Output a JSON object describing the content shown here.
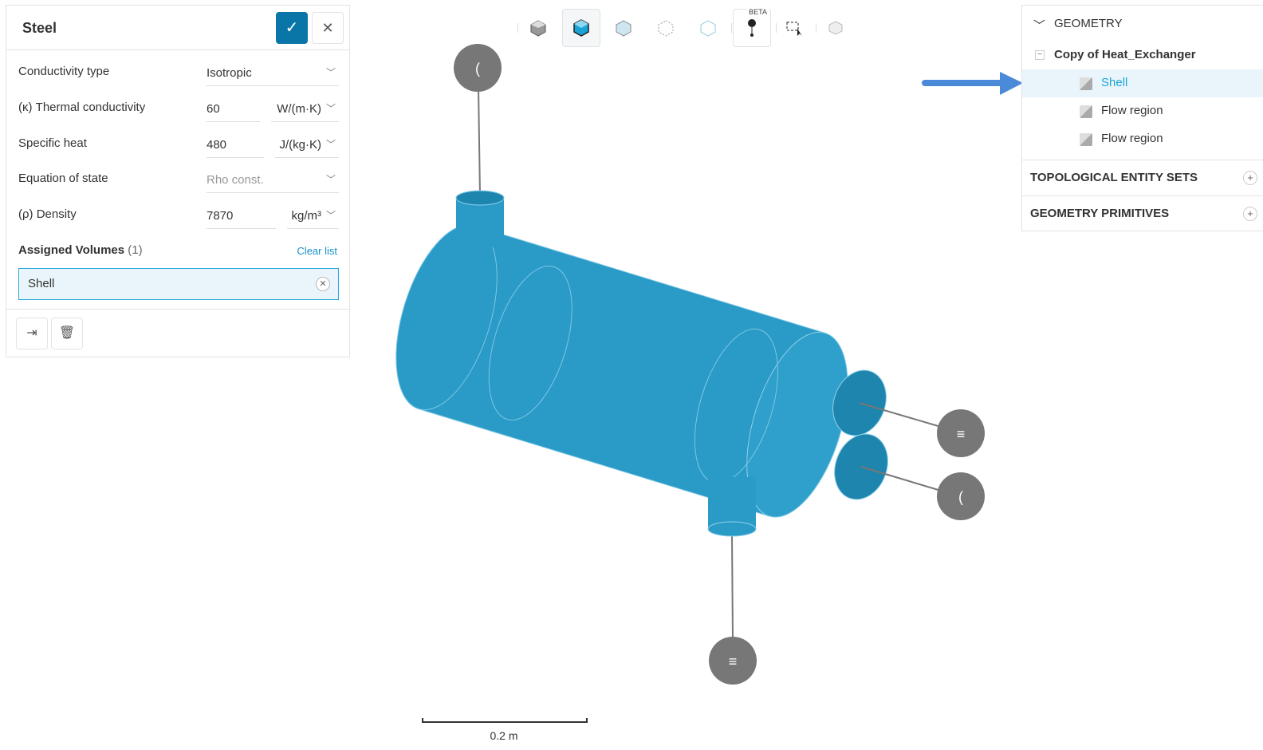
{
  "panel": {
    "title": "Steel",
    "confirm_icon": "check-icon",
    "close_icon": "close-icon",
    "rows": [
      {
        "label": "Conductivity type",
        "value": "Isotropic"
      },
      {
        "label": "(κ) Thermal conductivity",
        "value": "60",
        "unit": "W/(m·K)"
      },
      {
        "label": "Specific heat",
        "value": "480",
        "unit": "J/(kg·K)"
      },
      {
        "label": "Equation of state",
        "value": "Rho const."
      },
      {
        "label": "(ρ) Density",
        "value": "7870",
        "unit": "kg/m³"
      }
    ],
    "assigned_label": "Assigned Volumes",
    "assigned_count": "(1)",
    "clear_list": "Clear list",
    "assigned_items": [
      "Shell"
    ]
  },
  "toolbar": {
    "beta": "BETA"
  },
  "tree": {
    "geometry": "GEOMETRY",
    "root": "Copy of Heat_Exchanger",
    "items": [
      "Shell",
      "Flow region",
      "Flow region"
    ],
    "topological": "TOPOLOGICAL ENTITY SETS",
    "primitives": "GEOMETRY PRIMITIVES"
  },
  "scale": {
    "label": "0.2 m"
  },
  "colors": {
    "accent": "#0a76a8",
    "selection": "#1aa4d6",
    "model": "#2a9ac6",
    "arrow": "#4a8ad8"
  }
}
